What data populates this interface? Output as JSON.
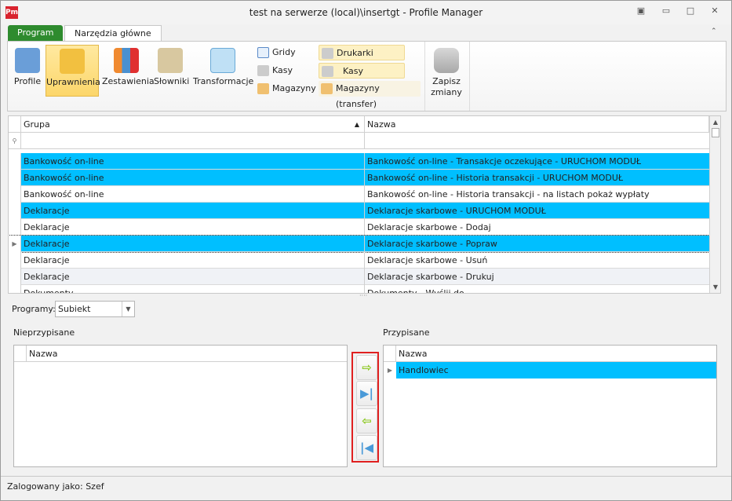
{
  "window": {
    "title": "test na serwerze (local)\\insertgt - Profile Manager",
    "logo": "Pm"
  },
  "tabs": [
    {
      "label": "Program"
    },
    {
      "label": "Narzędzia główne"
    }
  ],
  "ribbon": {
    "big": [
      {
        "label": "Profile",
        "icon": "users-icon"
      },
      {
        "label": "Uprawnienia",
        "icon": "badge-icon",
        "selected": true
      },
      {
        "label": "Zestawienia",
        "icon": "bar-chart-icon"
      },
      {
        "label": "Słowniki",
        "icon": "book-icon"
      },
      {
        "label": "Transformacje",
        "icon": "magnify-table-icon"
      }
    ],
    "small1": [
      {
        "label": "Gridy"
      },
      {
        "label": "Kasy"
      },
      {
        "label": "Magazyny"
      }
    ],
    "small2": [
      {
        "label": "Drukarki fiskalne"
      },
      {
        "label": "Kasy (transfer)"
      },
      {
        "label": "Magazyny (transfer)"
      }
    ],
    "save_line1": "Zapisz",
    "save_line2": "zmiany"
  },
  "grid": {
    "columns": [
      "Grupa",
      "Nazwa"
    ],
    "rows": [
      {
        "grupa": "Bankowość on-line",
        "nazwa": "Bankowość on-line - Transakcje oczekujące - URUCHOM MODUŁ",
        "selected": true
      },
      {
        "grupa": "Bankowość on-line",
        "nazwa": "Bankowość on-line - Historia transakcji - URUCHOM MODUŁ",
        "selected": true
      },
      {
        "grupa": "Bankowość on-line",
        "nazwa": "Bankowość on-line - Historia transakcji - na listach pokaż wypłaty",
        "selected": false
      },
      {
        "grupa": "Deklaracje",
        "nazwa": "Deklaracje skarbowe - URUCHOM MODUŁ",
        "selected": true
      },
      {
        "grupa": "Deklaracje",
        "nazwa": "Deklaracje skarbowe - Dodaj",
        "selected": false
      },
      {
        "grupa": "Deklaracje",
        "nazwa": "Deklaracje skarbowe - Popraw",
        "selected": true,
        "current": true
      },
      {
        "grupa": "Deklaracje",
        "nazwa": "Deklaracje skarbowe - Usuń",
        "selected": false
      },
      {
        "grupa": "Deklaracje",
        "nazwa": "Deklaracje skarbowe - Drukuj",
        "selected": false
      },
      {
        "grupa": "Dokumenty",
        "nazwa": "Dokumenty - Wyślij do",
        "selected": false
      }
    ]
  },
  "programy": {
    "label": "Programy:",
    "value": "Subiekt"
  },
  "unassigned": {
    "title": "Nieprzypisane",
    "column": "Nazwa"
  },
  "assigned": {
    "title": "Przypisane",
    "column": "Nazwa",
    "items": [
      "Handlowiec"
    ]
  },
  "status": "Zalogowany jako: Szef",
  "colors": {
    "selection": "#00bfff",
    "accent": "#2e8b2e",
    "highlight_border": "#e02020"
  }
}
